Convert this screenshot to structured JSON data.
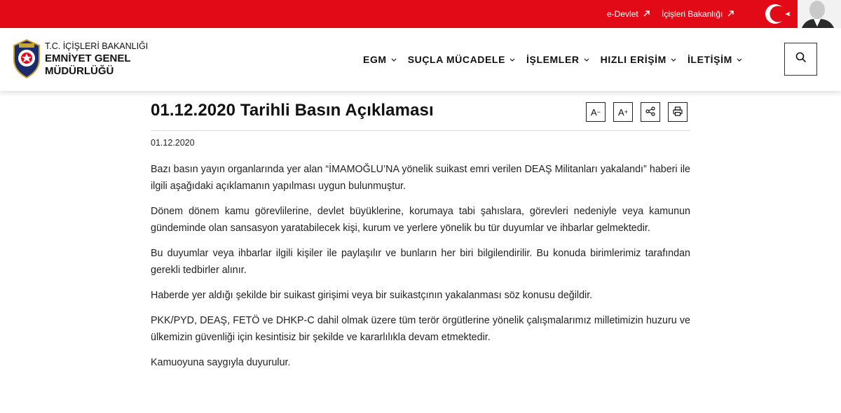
{
  "topbar": {
    "links": [
      {
        "label": "e-Devlet"
      },
      {
        "label": "İçişleri Bakanlığı"
      }
    ]
  },
  "brand": {
    "sub": "T.C. İÇİŞLERİ BAKANLIĞI",
    "line1": "EMNİYET GENEL",
    "line2": "MÜDÜRLÜĞÜ",
    "logo_text": "POLİS"
  },
  "nav": {
    "items": [
      {
        "label": "EGM"
      },
      {
        "label": "SUÇLA MÜCADELE"
      },
      {
        "label": "İŞLEMLER"
      },
      {
        "label": "HIZLI ERİŞİM"
      },
      {
        "label": "İLETİŞİM"
      }
    ]
  },
  "article": {
    "title": "01.12.2020 Tarihli Basın Açıklaması",
    "date": "01.12.2020",
    "paragraphs": [
      "Bazı basın yayın organlarında yer alan “İMAMOĞLU’NA yönelik suikast emri verilen DEAŞ Militanları yakalandı” haberi ile ilgili aşağıdaki açıklamanın yapılması uygun bulunmuştur.",
      "Dönem dönem kamu görevlilerine, devlet büyüklerine, korumaya tabi şahıslara, görevleri nedeniyle veya kamunun gündeminde olan sansasyon yaratabilecek kişi, kurum ve yerlere yönelik bu tür duyumlar ve ihbarlar gelmektedir.",
      "Bu duyumlar veya ihbarlar ilgili kişiler ile paylaşılır ve bunların her biri bilgilendirilir. Bu konuda birimlerimiz tarafından gerekli tedbirler alınır.",
      "Haberde yer aldığı şekilde bir suikast girişimi veya bir suikastçının yakalanması söz konusu değildir.",
      "PKK/PYD, DEAŞ, FETÖ ve DHKP-C dahil olmak üzere tüm terör örgütlerine yönelik çalışmalarımız milletimizin huzuru ve ülkemizin güvenliği için kesintisiz bir şekilde ve kararlılıkla devam etmektedir.",
      "Kamuoyuna saygıyla duyurulur."
    ]
  },
  "tools": {
    "font_decrease": "A",
    "font_decrease_sign": "−",
    "font_increase": "A",
    "font_increase_sign": "+",
    "share_icon": "share-icon",
    "print_icon": "print-icon"
  },
  "colors": {
    "topbar": "#e30a17",
    "text": "#111111",
    "divider": "#dddddd"
  }
}
